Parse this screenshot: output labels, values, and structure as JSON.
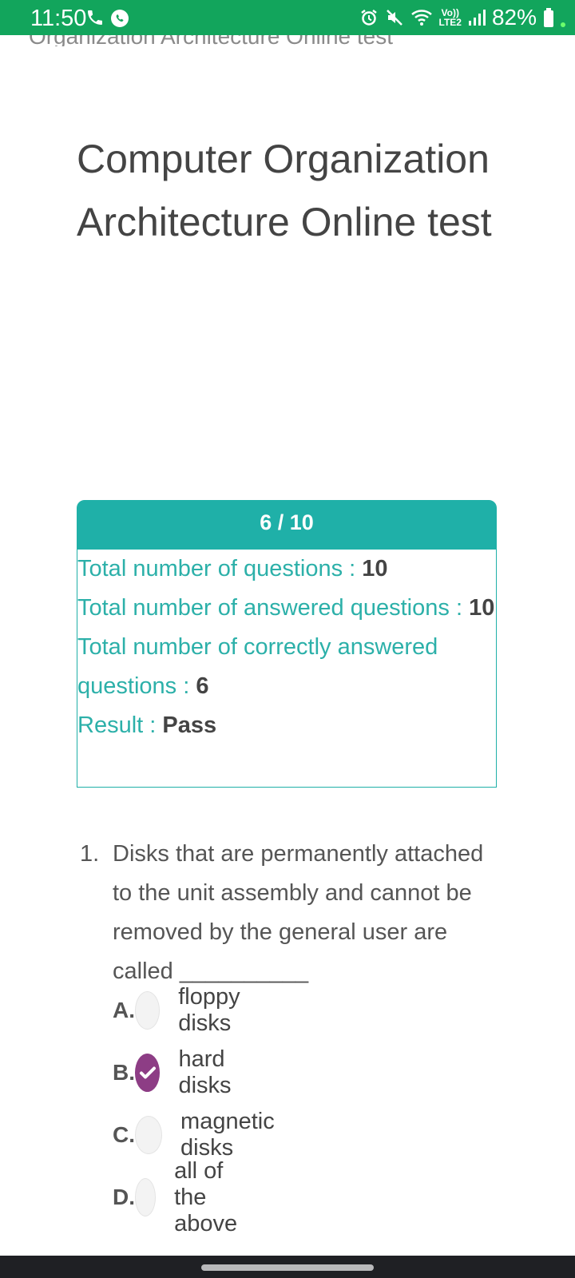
{
  "status_bar": {
    "time": "11:50",
    "volte_top": "Vo))",
    "volte_bottom": "LTE2",
    "battery": "82%"
  },
  "header": {
    "scrolled_title": "Organization Architecture Online test"
  },
  "page": {
    "title": "Computer Organization Architecture Online test"
  },
  "score_card": {
    "score": "6 / 10",
    "total_questions_label": "Total number of questions : ",
    "total_questions_value": "10",
    "answered_label": "Total number of answered questions : ",
    "answered_value": "10",
    "correct_label": "Total number of correctly answered questions : ",
    "correct_value": "6",
    "result_label": "Result : ",
    "result_value": "Pass"
  },
  "question": {
    "number": "1.",
    "text": "Disks that are permanently attached to the unit assembly and cannot be removed by the general user are called __________",
    "options": [
      {
        "letter": "A.",
        "text": "floppy disks",
        "selected": false
      },
      {
        "letter": "B.",
        "text": "hard disks",
        "selected": true
      },
      {
        "letter": "C.",
        "text": "magnetic disks",
        "selected": false
      },
      {
        "letter": "D.",
        "text": "all of the above",
        "selected": false
      }
    ]
  },
  "colors": {
    "status_bar": "#12a55c",
    "accent_teal": "#1fb0a8",
    "selected_radio": "#8d3d85"
  }
}
